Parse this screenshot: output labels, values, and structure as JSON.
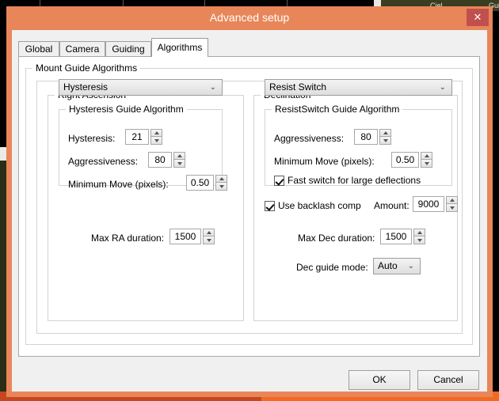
{
  "desktop": {
    "taskbar_items": [
      "Ciel",
      "Gui"
    ]
  },
  "window": {
    "title": "Advanced setup",
    "close_label": "✕"
  },
  "tabs": [
    {
      "label": "Global",
      "active": false
    },
    {
      "label": "Camera",
      "active": false
    },
    {
      "label": "Guiding",
      "active": false
    },
    {
      "label": "Algorithms",
      "active": true
    }
  ],
  "groups": {
    "mount": "Mount Guide Algorithms",
    "right_ascension": "Right Ascension",
    "declination": "Declination",
    "hysteresis_algo": "Hysteresis Guide Algorithm",
    "resistswitch_algo": "ResistSwitch Guide Algorithm"
  },
  "ra": {
    "algorithm_selected": "Hysteresis",
    "hysteresis_label": "Hysteresis:",
    "hysteresis_value": "21",
    "aggressiveness_label": "Aggressiveness:",
    "aggressiveness_value": "80",
    "min_move_label": "Minimum Move (pixels):",
    "min_move_value": "0.50",
    "max_duration_label": "Max RA duration:",
    "max_duration_value": "1500"
  },
  "dec": {
    "algorithm_selected": "Resist Switch",
    "aggressiveness_label": "Aggressiveness:",
    "aggressiveness_value": "80",
    "min_move_label": "Minimum Move (pixels):",
    "min_move_value": "0.50",
    "fast_switch_label": "Fast switch for large deflections",
    "backlash_label": "Use backlash comp",
    "amount_label": "Amount:",
    "amount_value": "9000",
    "max_duration_label": "Max Dec duration:",
    "max_duration_value": "1500",
    "guide_mode_label": "Dec guide mode:",
    "guide_mode_value": "Auto"
  },
  "buttons": {
    "ok": "OK",
    "cancel": "Cancel"
  },
  "icons": {
    "chevron_down": "⌄"
  },
  "colors": {
    "window_frame": "#e8865a",
    "close_button": "#c0504d",
    "client": "#f0f0f0",
    "tab_active": "#ffffff",
    "desktop_bottom": "#f26a22"
  }
}
